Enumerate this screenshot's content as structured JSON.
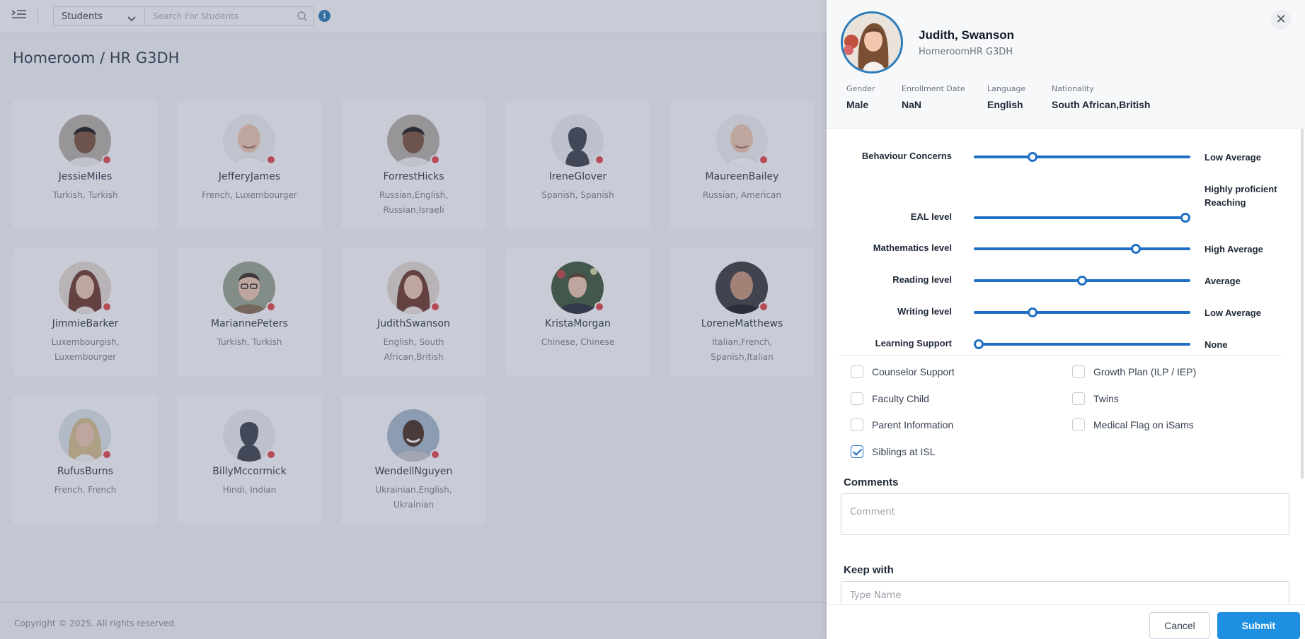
{
  "topbar": {
    "select_value": "Students",
    "search_placeholder": "Search For Students"
  },
  "page": {
    "title": "Homeroom / HR G3DH",
    "footer": "Copyright © 2025. All rights reserved."
  },
  "students": [
    {
      "name": "JessieMiles",
      "nationality": "Turkish, Turkish",
      "avatar": "photo-dark-hair"
    },
    {
      "name": "JefferyJames",
      "nationality": "French, Luxembourger",
      "avatar": "photo-bald"
    },
    {
      "name": "ForrestHicks",
      "nationality": "Russian,English, Russian,Israeli",
      "avatar": "photo-dark-hair"
    },
    {
      "name": "IreneGlover",
      "nationality": "Spanish, Spanish",
      "avatar": "silhouette"
    },
    {
      "name": "MaureenBailey",
      "nationality": "Russian, American",
      "avatar": "photo-bald"
    },
    {
      "name": "JimmieBarker",
      "nationality": "Luxembourgish, Luxembourger",
      "avatar": "photo-long-hair"
    },
    {
      "name": "MariannePeters",
      "nationality": "Turkish, Turkish",
      "avatar": "photo-glasses"
    },
    {
      "name": "JudithSwanson",
      "nationality": "English, South African,British",
      "avatar": "photo-long-hair"
    },
    {
      "name": "KristaMorgan",
      "nationality": "Chinese, Chinese",
      "avatar": "photo-suit"
    },
    {
      "name": "LoreneMatthews",
      "nationality": "Italian,French, Spanish,Italian",
      "avatar": "photo-bald-dark"
    },
    {
      "name": "RufusBurns",
      "nationality": "French, French",
      "avatar": "photo-blonde"
    },
    {
      "name": "BillyMccormick",
      "nationality": "Hindi, Indian",
      "avatar": "silhouette"
    },
    {
      "name": "WendellNguyen",
      "nationality": "Ukrainian,English, Ukrainian",
      "avatar": "photo-smiling"
    }
  ],
  "drawer": {
    "name": "Judith, Swanson",
    "subtitle": "HomeroomHR G3DH",
    "meta": [
      {
        "label": "Gender",
        "value": "Male"
      },
      {
        "label": "Enrollment Date",
        "value": "NaN"
      },
      {
        "label": "Language",
        "value": "English"
      },
      {
        "label": "Nationality",
        "value": "South African,British"
      }
    ],
    "sliders": [
      {
        "label": "Behaviour Concerns",
        "value_text": "Low Average",
        "level": 0.26
      },
      {
        "label": "EAL level",
        "value_text": "Highly proficient Reaching",
        "level": 1.0
      },
      {
        "label": "Mathematics level",
        "value_text": "High Average",
        "level": 0.76
      },
      {
        "label": "Reading level",
        "value_text": "Average",
        "level": 0.5
      },
      {
        "label": "Writing level",
        "value_text": "Low Average",
        "level": 0.26
      },
      {
        "label": "Learning Support",
        "value_text": "None",
        "level": 0.0
      }
    ],
    "checkboxes": [
      {
        "label": "Counselor Support",
        "checked": false
      },
      {
        "label": "Growth Plan (ILP / IEP)",
        "checked": false
      },
      {
        "label": "Faculty Child",
        "checked": false
      },
      {
        "label": "Twins",
        "checked": false
      },
      {
        "label": "Parent Information",
        "checked": false
      },
      {
        "label": "Medical Flag on iSams",
        "checked": false
      },
      {
        "label": "Siblings at ISL",
        "checked": true
      }
    ],
    "comments_title": "Comments",
    "comments_placeholder": "Comment",
    "keep_with_title": "Keep with",
    "keep_with_placeholder": "Type Name",
    "cancel_label": "Cancel",
    "submit_label": "Submit"
  },
  "colors": {
    "accent": "#1f6fc4",
    "submit": "#1e8fe1",
    "status_dot": "#e5484d",
    "profile_ring": "#2a7ab8"
  }
}
